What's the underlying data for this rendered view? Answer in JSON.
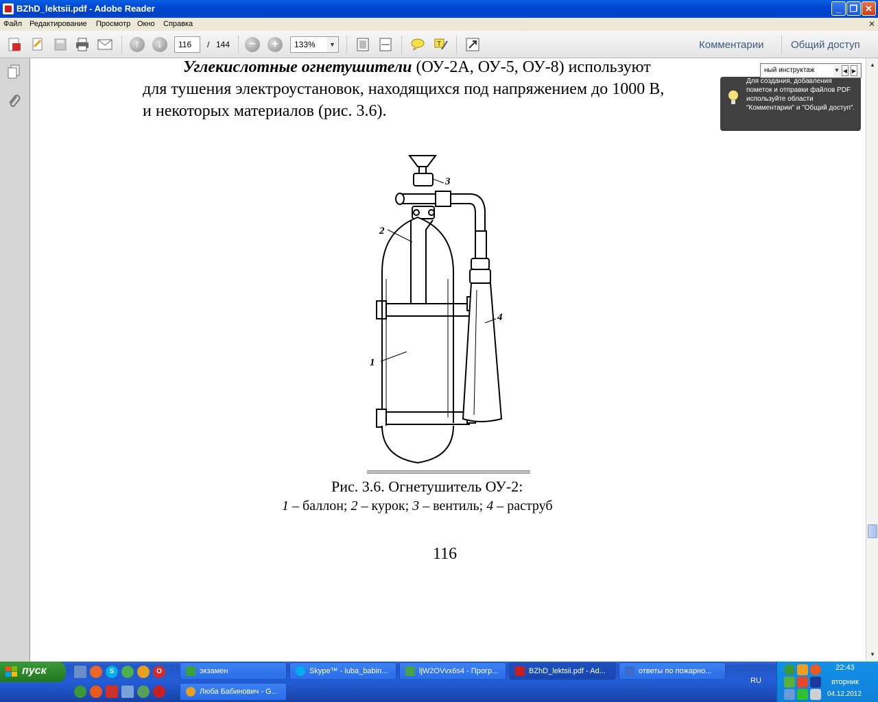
{
  "window": {
    "title": "BZhD_lektsii.pdf - Adobe Reader"
  },
  "menu": [
    "Файл",
    "Редактирование",
    "Просмотр",
    "Окно",
    "Справка"
  ],
  "toolbar": {
    "current_page": "116",
    "page_separator": "/",
    "total_pages": "144",
    "zoom": "133%",
    "comments_link": "Комментарии",
    "share_link": "Общий доступ"
  },
  "find": {
    "value": "ный инструктаж"
  },
  "tooltip": {
    "text": "Для создания, добавления пометок и отправки файлов PDF используйте области \"Комментарии\" и \"Общий доступ\"."
  },
  "document": {
    "para_lead": "Углекислотные огнетушители",
    "para_line1_rest": " (ОУ-2А, ОУ-5, ОУ-8) используют",
    "para_line2": "для тушения электроустановок, находящихся под напряжением до 1000 В,",
    "para_line3": "и некоторых материалов (рис. 3.6).",
    "figure_labels": [
      "1",
      "2",
      "3",
      "4"
    ],
    "caption_title": "Рис. 3.6. Огнетушитель ОУ-2:",
    "caption_items": [
      {
        "num": "1",
        "text": " – баллон; "
      },
      {
        "num": "2",
        "text": " – курок; "
      },
      {
        "num": "3",
        "text": " – вентиль; "
      },
      {
        "num": "4",
        "text": " – раструб"
      }
    ],
    "page_number": "116"
  },
  "taskbar": {
    "start": "пуск",
    "tasks_row1": [
      {
        "label": "экзамен",
        "color": "#3aa23a"
      },
      {
        "label": "Skype™ - luba_babin...",
        "color": "#00aff0"
      },
      {
        "label": "ljW2OVvx6s4 - Прогр...",
        "color": "#4aa04a"
      },
      {
        "label": "BZhD_lektsii.pdf - Ad...",
        "color": "#c81e1e"
      },
      {
        "label": "ответы по пожарно...",
        "color": "#3c6ac8"
      }
    ],
    "tasks_row2": [
      {
        "label": "Люба Бабинович - G...",
        "color": "#e8a020"
      }
    ],
    "lang": "RU",
    "time": "22:43",
    "day": "вторник",
    "date": "04.12.2012"
  }
}
